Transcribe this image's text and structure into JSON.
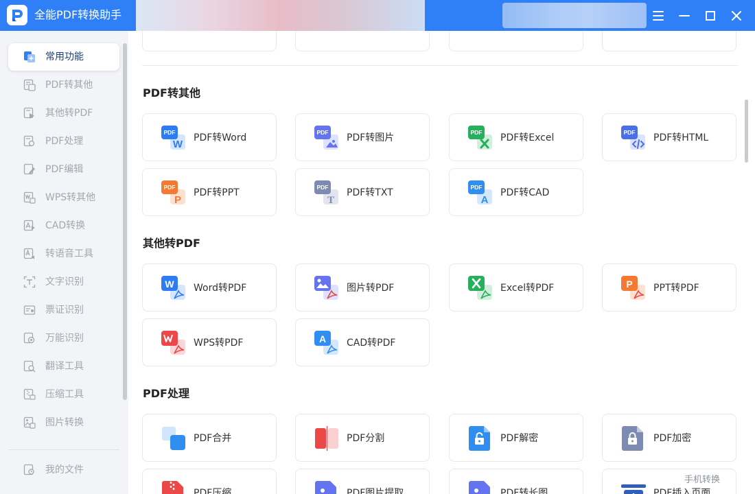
{
  "app": {
    "title": "全能PDF转换助手",
    "brand_color": "#2f80f6",
    "controls": [
      "menu-icon",
      "minimize-icon",
      "maximize-icon",
      "close-icon"
    ]
  },
  "sidebar": {
    "items": [
      {
        "label": "常用功能",
        "icon": "common-functions-icon",
        "active": true
      },
      {
        "label": "PDF转其他",
        "icon": "pdf-convert-icon"
      },
      {
        "label": "其他转PDF",
        "icon": "to-pdf-icon"
      },
      {
        "label": "PDF处理",
        "icon": "pdf-process-icon"
      },
      {
        "label": "PDF编辑",
        "icon": "pdf-edit-icon"
      },
      {
        "label": "WPS转其他",
        "icon": "wps-convert-icon"
      },
      {
        "label": "CAD转换",
        "icon": "cad-convert-icon"
      },
      {
        "label": "转语音工具",
        "icon": "voice-tool-icon"
      },
      {
        "label": "文字识别",
        "icon": "text-ocr-icon"
      },
      {
        "label": "票证识别",
        "icon": "ticket-ocr-icon"
      },
      {
        "label": "万能识别",
        "icon": "universal-ocr-icon"
      },
      {
        "label": "翻译工具",
        "icon": "translate-icon"
      },
      {
        "label": "压缩工具",
        "icon": "compress-icon"
      },
      {
        "label": "图片转换",
        "icon": "image-convert-icon"
      }
    ],
    "bottom_item": {
      "label": "我的文件",
      "icon": "my-files-icon"
    }
  },
  "sections": [
    {
      "title": "PDF转其他",
      "cards": [
        {
          "label": "PDF转Word",
          "icon": "pdf-to-word-icon",
          "color": "#2d7cf6"
        },
        {
          "label": "PDF转图片",
          "icon": "pdf-to-image-icon",
          "color": "#6473f0"
        },
        {
          "label": "PDF转Excel",
          "icon": "pdf-to-excel-icon",
          "color": "#27b05c"
        },
        {
          "label": "PDF转HTML",
          "icon": "pdf-to-html-icon",
          "color": "#4a6fe8"
        },
        {
          "label": "PDF转PPT",
          "icon": "pdf-to-ppt-icon",
          "color": "#f47a33"
        },
        {
          "label": "PDF转TXT",
          "icon": "pdf-to-txt-icon",
          "color": "#7d8ab1"
        },
        {
          "label": "PDF转CAD",
          "icon": "pdf-to-cad-icon",
          "color": "#2f8ef0"
        }
      ]
    },
    {
      "title": "其他转PDF",
      "cards": [
        {
          "label": "Word转PDF",
          "icon": "word-to-pdf-icon",
          "color": "#2d7cf6"
        },
        {
          "label": "图片转PDF",
          "icon": "image-to-pdf-icon",
          "color": "#6473f0"
        },
        {
          "label": "Excel转PDF",
          "icon": "excel-to-pdf-icon",
          "color": "#27b05c"
        },
        {
          "label": "PPT转PDF",
          "icon": "ppt-to-pdf-icon",
          "color": "#f47a33"
        },
        {
          "label": "WPS转PDF",
          "icon": "wps-to-pdf-icon",
          "color": "#ec4848"
        },
        {
          "label": "CAD转PDF",
          "icon": "cad-to-pdf-icon",
          "color": "#2f8ef0"
        }
      ]
    },
    {
      "title": "PDF处理",
      "cards": [
        {
          "label": "PDF合并",
          "icon": "pdf-merge-icon",
          "color": "#2f8ef0"
        },
        {
          "label": "PDF分割",
          "icon": "pdf-split-icon",
          "color": "#ec4848"
        },
        {
          "label": "PDF解密",
          "icon": "pdf-decrypt-icon",
          "color": "#2f8ef0"
        },
        {
          "label": "PDF加密",
          "icon": "pdf-encrypt-icon",
          "color": "#7d8ab1"
        },
        {
          "label": "PDF压缩",
          "icon": "pdf-compress-icon",
          "color": "#ec4848"
        },
        {
          "label": "PDF图片提取",
          "icon": "pdf-image-extract-icon",
          "color": "#6473f0"
        },
        {
          "label": "PDF转长图",
          "icon": "pdf-long-image-icon",
          "color": "#6473f0"
        },
        {
          "label": "PDF插入页面",
          "icon": "pdf-insert-page-icon",
          "color": "#2f5fb8"
        }
      ]
    }
  ],
  "mobile_link": "手机转换"
}
